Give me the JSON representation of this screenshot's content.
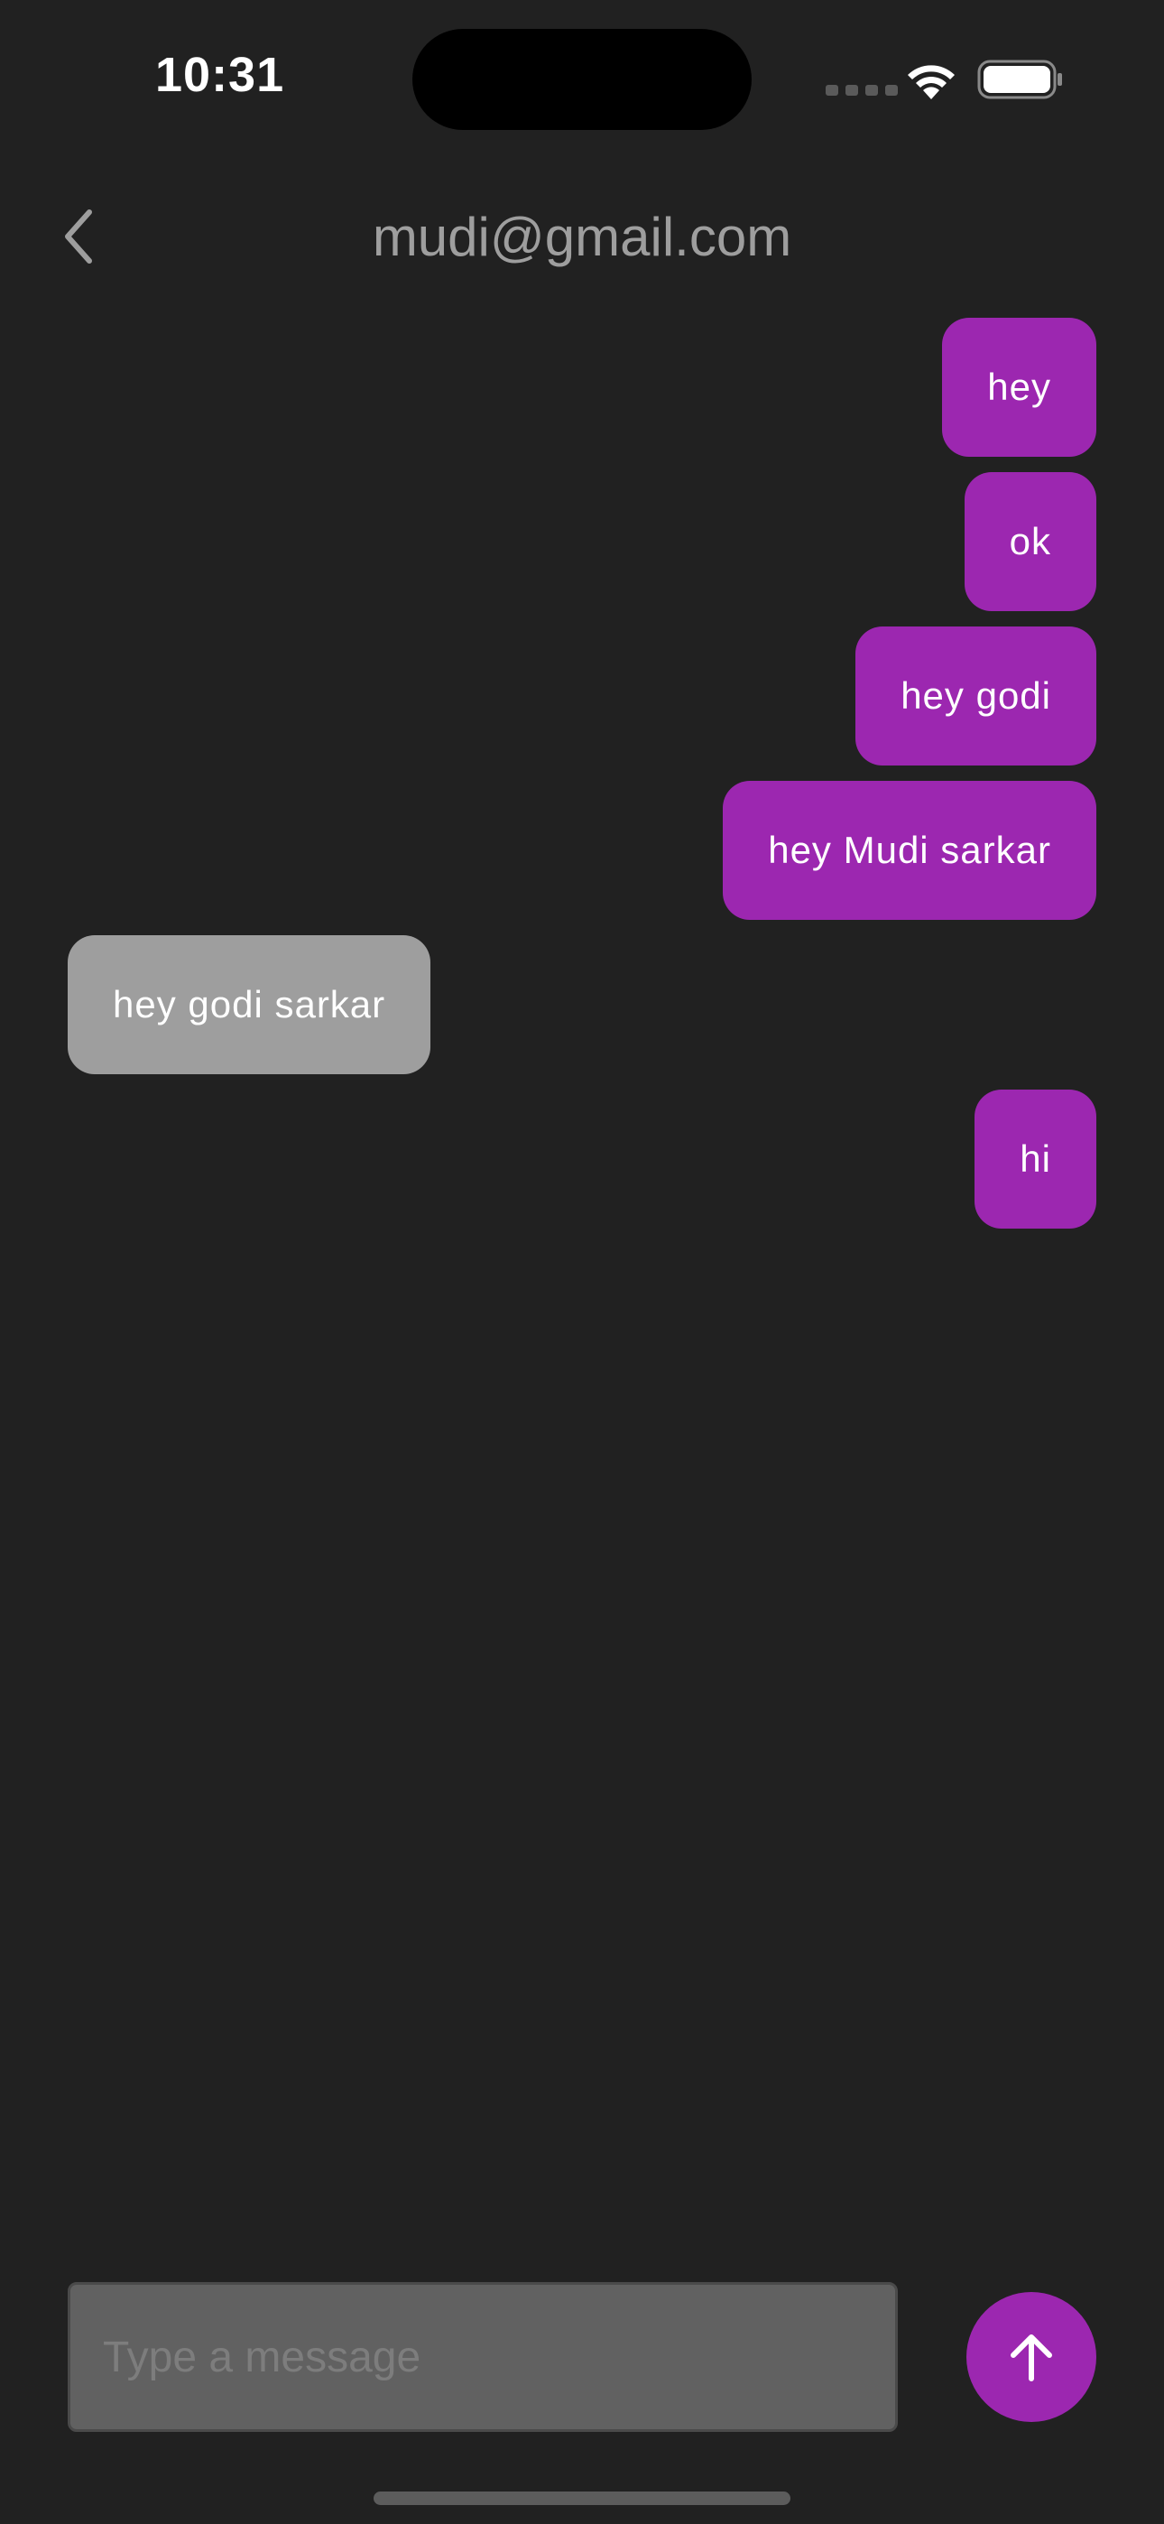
{
  "status_bar": {
    "time": "10:31",
    "icons": [
      "cellular-signal-icon",
      "wifi-icon",
      "battery-icon"
    ]
  },
  "header": {
    "back_icon": "chevron-left-icon",
    "title": "mudi@gmail.com"
  },
  "messages": [
    {
      "text": "hey",
      "direction": "sent"
    },
    {
      "text": "ok",
      "direction": "sent"
    },
    {
      "text": "hey godi",
      "direction": "sent"
    },
    {
      "text": "hey Mudi sarkar",
      "direction": "sent"
    },
    {
      "text": "hey godi sarkar",
      "direction": "received"
    },
    {
      "text": "hi",
      "direction": "sent"
    }
  ],
  "composer": {
    "placeholder": "Type a message",
    "value": "",
    "send_icon": "arrow-up-icon"
  },
  "colors": {
    "background": "#212121",
    "sent_bubble": "#9c27b0",
    "received_bubble": "#9e9e9e",
    "input_background": "#616161",
    "title_text": "#9e9e9e"
  }
}
